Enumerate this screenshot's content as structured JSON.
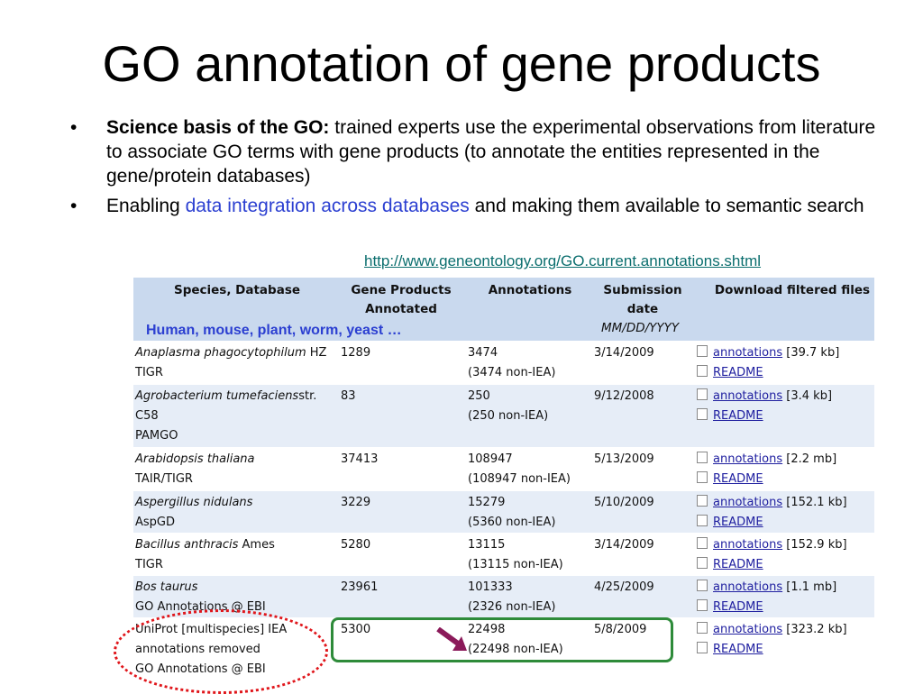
{
  "title": "GO annotation of gene products",
  "bullets": [
    {
      "bold": "Science basis of the GO:",
      "text": " trained experts use the experimental observations from literature to associate GO terms with gene products (to annotate the entities represented in the gene/protein databases)"
    },
    {
      "pre": "Enabling ",
      "highlight": "data integration across databases",
      "post": " and making them available to semantic search"
    }
  ],
  "url": "http://www.geneontology.org/GO.current.annotations.shtml",
  "table": {
    "headers": {
      "species": "Species, Database",
      "gene_products": "Gene Products",
      "gene_products2": "Annotated",
      "annotations": "Annotations",
      "submission": "Submission",
      "submission2": "date",
      "submission_fmt": "MM/DD/YYYY",
      "download": "Download filtered files",
      "species_hint": "Human, mouse, plant, worm, yeast …"
    },
    "rows": [
      {
        "species": "Anaplasma phagocytophilum",
        "species_suffix": " HZ",
        "db": [
          "TIGR"
        ],
        "genes": "1289",
        "ann": "3474",
        "ann_sub": "(3474 non-IEA)",
        "date": "3/14/2009",
        "file": "annotations",
        "size": "[39.7 kb]",
        "readme": "README"
      },
      {
        "species": "Agrobacterium tumefaciens",
        "species_suffix": "str.",
        "db": [
          "C58",
          "PAMGO"
        ],
        "genes": "83",
        "ann": "250",
        "ann_sub": "(250 non-IEA)",
        "date": "9/12/2008",
        "file": "annotations",
        "size": "[3.4 kb]",
        "readme": "README"
      },
      {
        "species": "Arabidopsis thaliana",
        "species_suffix": "",
        "db": [
          "TAIR/TIGR"
        ],
        "genes": "37413",
        "ann": "108947",
        "ann_sub": "(108947 non-IEA)",
        "date": "5/13/2009",
        "file": "annotations",
        "size": "[2.2 mb]",
        "readme": "README"
      },
      {
        "species": "Aspergillus nidulans",
        "species_suffix": "",
        "db": [
          "AspGD"
        ],
        "genes": "3229",
        "ann": "15279",
        "ann_sub": "(5360 non-IEA)",
        "date": "5/10/2009",
        "file": "annotations",
        "size": "[152.1 kb]",
        "readme": "README"
      },
      {
        "species": "Bacillus anthracis",
        "species_suffix": " Ames",
        "db": [
          "TIGR"
        ],
        "genes": "5280",
        "ann": "13115",
        "ann_sub": "(13115 non-IEA)",
        "date": "3/14/2009",
        "file": "annotations",
        "size": "[152.9 kb]",
        "readme": "README"
      },
      {
        "species": "Bos taurus",
        "species_suffix": "",
        "db": [
          "GO Annotations @ EBI"
        ],
        "genes": "23961",
        "ann": "101333",
        "ann_sub": "(2326 non-IEA)",
        "date": "4/25/2009",
        "file": "annotations",
        "size": "[1.1 mb]",
        "readme": "README"
      },
      {
        "species": "",
        "species_plain": "UniProt [multispecies] IEA",
        "db": [
          "annotations removed",
          "GO Annotations @ EBI"
        ],
        "genes": "5300",
        "ann": "22498",
        "ann_sub": "(22498 non-IEA)",
        "date": "5/8/2009",
        "file": "annotations",
        "size": "[323.2 kb]",
        "readme": "README"
      }
    ]
  },
  "colors": {
    "header_bg": "#c9d9ee",
    "alt_row": "#e6edf7",
    "highlight_text": "#2b3fd1",
    "green_box": "#2e8b3a",
    "red_dots": "#e0161b",
    "arrow": "#8b1a5a"
  }
}
